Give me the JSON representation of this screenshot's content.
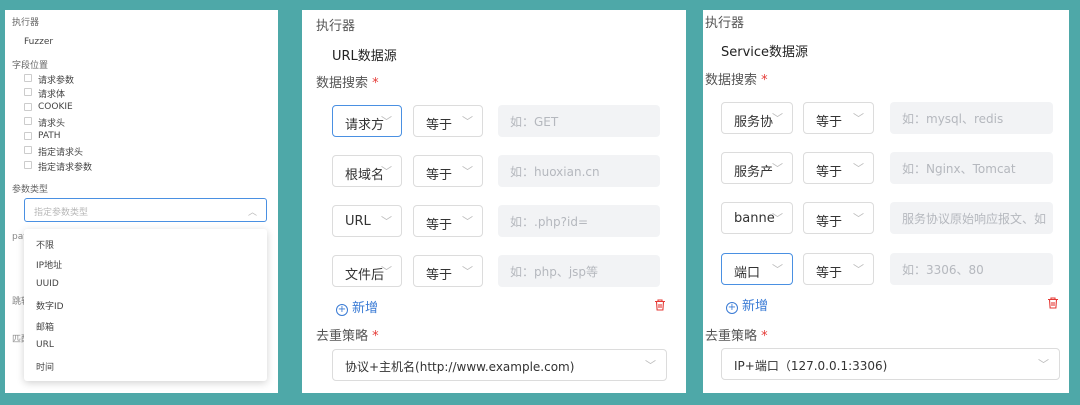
{
  "panel1": {
    "executor_label": "执行器",
    "executor_value": "Fuzzer",
    "field_position_label": "字段位置",
    "field_positions": [
      "请求参数",
      "请求体",
      "COOKIE",
      "请求头",
      "PATH",
      "指定请求头",
      "指定请求参数"
    ],
    "param_type_label": "参数类型",
    "param_type_placeholder": "指定参数类型",
    "param_type_options": [
      "不限",
      "IP地址",
      "UUID",
      "数字ID",
      "邮箱",
      "URL",
      "时间"
    ],
    "peek_labels": [
      "pay",
      "跳转",
      "匹配"
    ]
  },
  "panel2": {
    "executor_label": "执行器",
    "source_title": "URL数据源",
    "search_label": "数据搜索",
    "required_mark": "*",
    "rows": [
      {
        "field": "请求方",
        "op": "等于",
        "placeholder": "如：GET",
        "active": true
      },
      {
        "field": "根域名",
        "op": "等于",
        "placeholder": "如：huoxian.cn",
        "active": false
      },
      {
        "field": "URL",
        "op": "等于",
        "placeholder": "如：.php?id=",
        "active": false
      },
      {
        "field": "文件后",
        "op": "等于",
        "placeholder": "如：php、jsp等",
        "active": false
      }
    ],
    "add_label": "新增",
    "dedup_label": "去重策略",
    "dedup_value": "协议+主机名(http://www.example.com)"
  },
  "panel3": {
    "executor_label": "执行器",
    "source_title": "Service数据源",
    "search_label": "数据搜索",
    "required_mark": "*",
    "rows": [
      {
        "field": "服务协",
        "op": "等于",
        "placeholder": "如：mysql、redis",
        "active": false
      },
      {
        "field": "服务产",
        "op": "等于",
        "placeholder": "如：Nginx、Tomcat",
        "active": false
      },
      {
        "field": "banne",
        "op": "等于",
        "placeholder": "服务协议原始响应报文、如",
        "active": false
      },
      {
        "field": "端口",
        "op": "等于",
        "placeholder": "如：3306、80",
        "active": true
      }
    ],
    "add_label": "新增",
    "dedup_label": "去重策略",
    "dedup_value": "IP+端口（127.0.0.1:3306)"
  },
  "icons": {
    "chevron": "chevron-down-icon",
    "plus": "plus-circle-icon",
    "trash": "trash-icon"
  },
  "colors": {
    "accent": "#4a90e2",
    "required": "#e53935",
    "delete": "#e53935",
    "background": "#4ea8a8"
  }
}
